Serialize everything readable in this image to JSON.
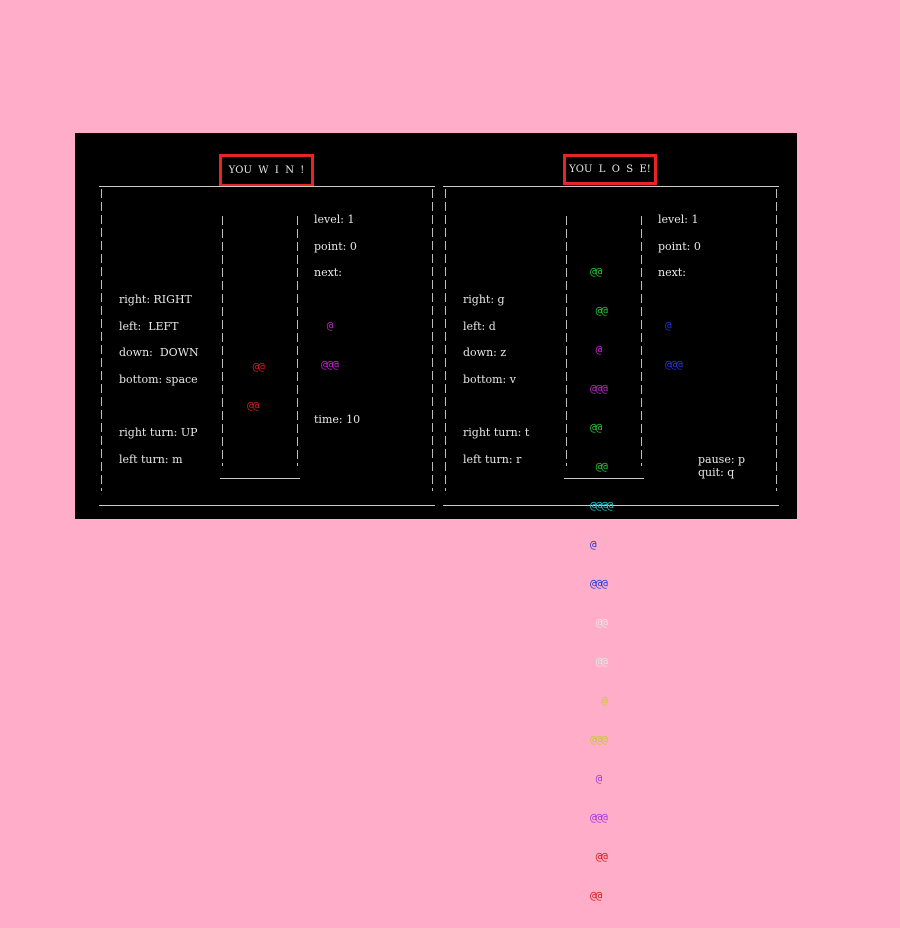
{
  "colors": {
    "background": "#ffadc8",
    "terminal": "#000000",
    "highlight": "#e8242b",
    "red": "#d81d1d",
    "magenta": "#c027c8",
    "green": "#27c43a",
    "cyan": "#21c7c9",
    "blue": "#2436d8",
    "white": "#e6e6e6",
    "yellow": "#c8c83a",
    "purple": "#a33ad2"
  },
  "player1": {
    "status": "YOU  W  I  N  !",
    "controls": {
      "right": "right: RIGHT",
      "left": "left:  LEFT",
      "down": "down:  DOWN",
      "bottom": "bottom: space",
      "right_turn": "right turn: UP",
      "left_turn": "left turn: m"
    },
    "info": {
      "level": "level: 1",
      "point": "point: 0",
      "next": "next:",
      "time": "time: 10"
    },
    "next_piece": [
      {
        "text": " @",
        "color": "magenta"
      },
      {
        "text": "@@@",
        "color": "magenta"
      }
    ],
    "falling_piece": [
      {
        "text": " @@",
        "color": "red"
      },
      {
        "text": "@@",
        "color": "red"
      }
    ]
  },
  "player2": {
    "status": "YOU  L  O  S  E!",
    "controls": {
      "right": "right: g",
      "left": "left: d",
      "down": "down: z",
      "bottom": "bottom: v",
      "right_turn": "right turn: t",
      "left_turn": "left turn: r"
    },
    "info": {
      "level": "level: 1",
      "point": "point: 0",
      "next": "next:"
    },
    "next_piece": [
      {
        "text": "@",
        "color": "blue"
      },
      {
        "text": "@@@",
        "color": "blue"
      }
    ],
    "stack": [
      {
        "text": "@@",
        "color": "green"
      },
      {
        "text": " @@",
        "color": "green"
      },
      {
        "text": " @",
        "color": "magenta"
      },
      {
        "text": "@@@",
        "color": "magenta"
      },
      {
        "text": "@@",
        "color": "green"
      },
      {
        "text": " @@",
        "color": "green"
      },
      {
        "text": "@@@@",
        "color": "cyan"
      },
      {
        "text": "@",
        "color": "blue"
      },
      {
        "text": "@@@",
        "color": "blue"
      },
      {
        "text": " @@",
        "color": "white"
      },
      {
        "text": " @@",
        "color": "white"
      },
      {
        "text": "  @",
        "color": "yellow"
      },
      {
        "text": "@@@",
        "color": "yellow"
      },
      {
        "text": " @",
        "color": "purple"
      },
      {
        "text": "@@@",
        "color": "purple"
      },
      {
        "text": " @@",
        "color": "red"
      },
      {
        "text": "@@",
        "color": "red"
      }
    ],
    "pause": "pause: p",
    "quit": "quit: q"
  }
}
